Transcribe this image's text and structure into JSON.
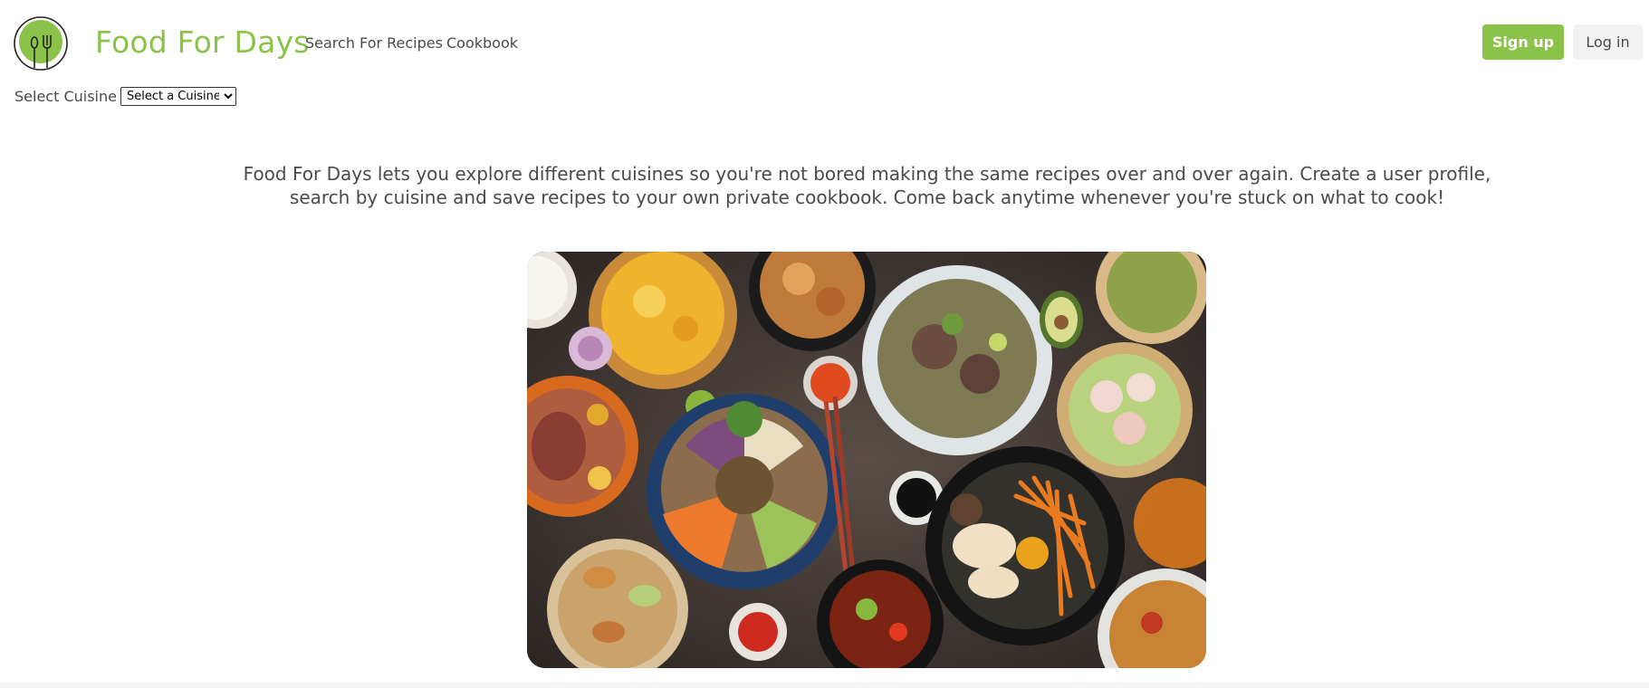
{
  "header": {
    "brand": "Food For Days",
    "logo_icon": "fork-knife-icon",
    "nav": {
      "search": "Search For Recipes",
      "cookbook": "Cookbook"
    },
    "signup_label": "Sign up",
    "login_label": "Log in"
  },
  "cuisine": {
    "label": "Select Cuisine",
    "selected": "Select a Cuisine"
  },
  "intro": {
    "text": "Food For Days lets you explore different cuisines so you're not bored making the same recipes over and over again. Create a user profile, search by cuisine and save recipes to your own private cookbook. Come back anytime whenever you're stuck on what to cook!"
  },
  "colors": {
    "brand_green": "#8bc34a",
    "text_gray": "#4a4a4a",
    "login_bg": "#f2f2f2"
  }
}
